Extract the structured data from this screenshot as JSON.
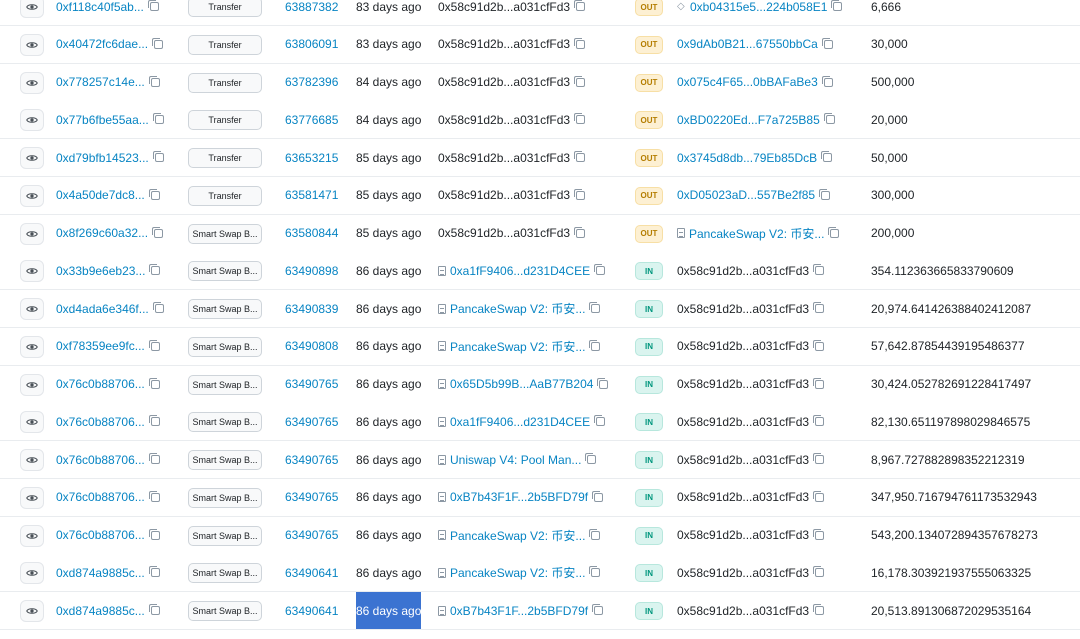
{
  "colors": {
    "link": "#0784c3",
    "out_badge_bg": "#fdf0d3",
    "out_badge_text": "#b47d00",
    "in_badge_bg": "#daf4ef",
    "in_badge_text": "#00967d",
    "selection": "#3b73d1"
  },
  "icons": {
    "view": "eye-icon",
    "copy": "copy-icon",
    "contract": "document-icon",
    "token": "diamond-icon"
  },
  "rows": [
    {
      "hash": "0xf118c40f5ab...",
      "method": "Transfer",
      "block": "63887382",
      "age": "83 days ago",
      "from": "0x58c91d2b...a031cfFd3",
      "direction": "OUT",
      "to": "0xb04315e5...224b058E1",
      "value": "6,666"
    },
    {
      "hash": "0x40472fc6dae...",
      "method": "Transfer",
      "block": "63806091",
      "age": "83 days ago",
      "from": "0x58c91d2b...a031cfFd3",
      "direction": "OUT",
      "to": "0x9dAb0B21...67550bbCa",
      "value": "30,000"
    },
    {
      "hash": "0x778257c14e...",
      "method": "Transfer",
      "block": "63782396",
      "age": "84 days ago",
      "from": "0x58c91d2b...a031cfFd3",
      "direction": "OUT",
      "to": "0x075c4F65...0bBAFaBe3",
      "value": "500,000"
    },
    {
      "hash": "0x77b6fbe55aa...",
      "method": "Transfer",
      "block": "63776685",
      "age": "84 days ago",
      "from": "0x58c91d2b...a031cfFd3",
      "direction": "OUT",
      "to": "0xBD0220Ed...F7a725B85",
      "value": "20,000"
    },
    {
      "hash": "0xd79bfb14523...",
      "method": "Transfer",
      "block": "63653215",
      "age": "85 days ago",
      "from": "0x58c91d2b...a031cfFd3",
      "direction": "OUT",
      "to": "0x3745d8db...79Eb85DcB",
      "value": "50,000"
    },
    {
      "hash": "0x4a50de7dc8...",
      "method": "Transfer",
      "block": "63581471",
      "age": "85 days ago",
      "from": "0x58c91d2b...a031cfFd3",
      "direction": "OUT",
      "to": "0xD05023aD...557Be2f85",
      "value": "300,000"
    },
    {
      "hash": "0x8f269c60a32...",
      "method": "Smart Swap B...",
      "block": "63580844",
      "age": "85 days ago",
      "from": "0x58c91d2b...a031cfFd3",
      "direction": "OUT",
      "to": "PancakeSwap V2: 币安...",
      "value": "200,000"
    },
    {
      "hash": "0x33b9e6eb23...",
      "method": "Smart Swap B...",
      "block": "63490898",
      "age": "86 days ago",
      "from": "0xa1fF9406...d231D4CEE",
      "direction": "IN",
      "to": "0x58c91d2b...a031cfFd3",
      "value": "354.112363665833790609"
    },
    {
      "hash": "0xd4ada6e346f...",
      "method": "Smart Swap B...",
      "block": "63490839",
      "age": "86 days ago",
      "from": "PancakeSwap V2: 币安...",
      "direction": "IN",
      "to": "0x58c91d2b...a031cfFd3",
      "value": "20,974.641426388402412087"
    },
    {
      "hash": "0xf78359ee9fc...",
      "method": "Smart Swap B...",
      "block": "63490808",
      "age": "86 days ago",
      "from": "PancakeSwap V2: 币安...",
      "direction": "IN",
      "to": "0x58c91d2b...a031cfFd3",
      "value": "57,642.87854439195486377"
    },
    {
      "hash": "0x76c0b88706...",
      "method": "Smart Swap B...",
      "block": "63490765",
      "age": "86 days ago",
      "from": "0x65D5b99B...AaB77B204",
      "direction": "IN",
      "to": "0x58c91d2b...a031cfFd3",
      "value": "30,424.052782691228417497"
    },
    {
      "hash": "0x76c0b88706...",
      "method": "Smart Swap B...",
      "block": "63490765",
      "age": "86 days ago",
      "from": "0xa1fF9406...d231D4CEE",
      "direction": "IN",
      "to": "0x58c91d2b...a031cfFd3",
      "value": "82,130.651197898029846575"
    },
    {
      "hash": "0x76c0b88706...",
      "method": "Smart Swap B...",
      "block": "63490765",
      "age": "86 days ago",
      "from": "Uniswap V4: Pool Man...",
      "direction": "IN",
      "to": "0x58c91d2b...a031cfFd3",
      "value": "8,967.727882898352212319"
    },
    {
      "hash": "0x76c0b88706...",
      "method": "Smart Swap B...",
      "block": "63490765",
      "age": "86 days ago",
      "from": "0xB7b43F1F...2b5BFD79f",
      "direction": "IN",
      "to": "0x58c91d2b...a031cfFd3",
      "value": "347,950.716794761173532943"
    },
    {
      "hash": "0x76c0b88706...",
      "method": "Smart Swap B...",
      "block": "63490765",
      "age": "86 days ago",
      "from": "PancakeSwap V2: 币安...",
      "direction": "IN",
      "to": "0x58c91d2b...a031cfFd3",
      "value": "543,200.134072894357678273"
    },
    {
      "hash": "0xd874a9885c...",
      "method": "Smart Swap B...",
      "block": "63490641",
      "age": "86 days ago",
      "from": "PancakeSwap V2: 币安...",
      "direction": "IN",
      "to": "0x58c91d2b...a031cfFd3",
      "value": "16,178.303921937555063325"
    },
    {
      "hash": "0xd874a9885c...",
      "method": "Smart Swap B...",
      "block": "63490641",
      "age": "86 days ago",
      "from": "0xB7b43F1F...2b5BFD79f",
      "direction": "IN",
      "to": "0x58c91d2b...a031cfFd3",
      "value": "20,513.891306872029535164"
    }
  ]
}
